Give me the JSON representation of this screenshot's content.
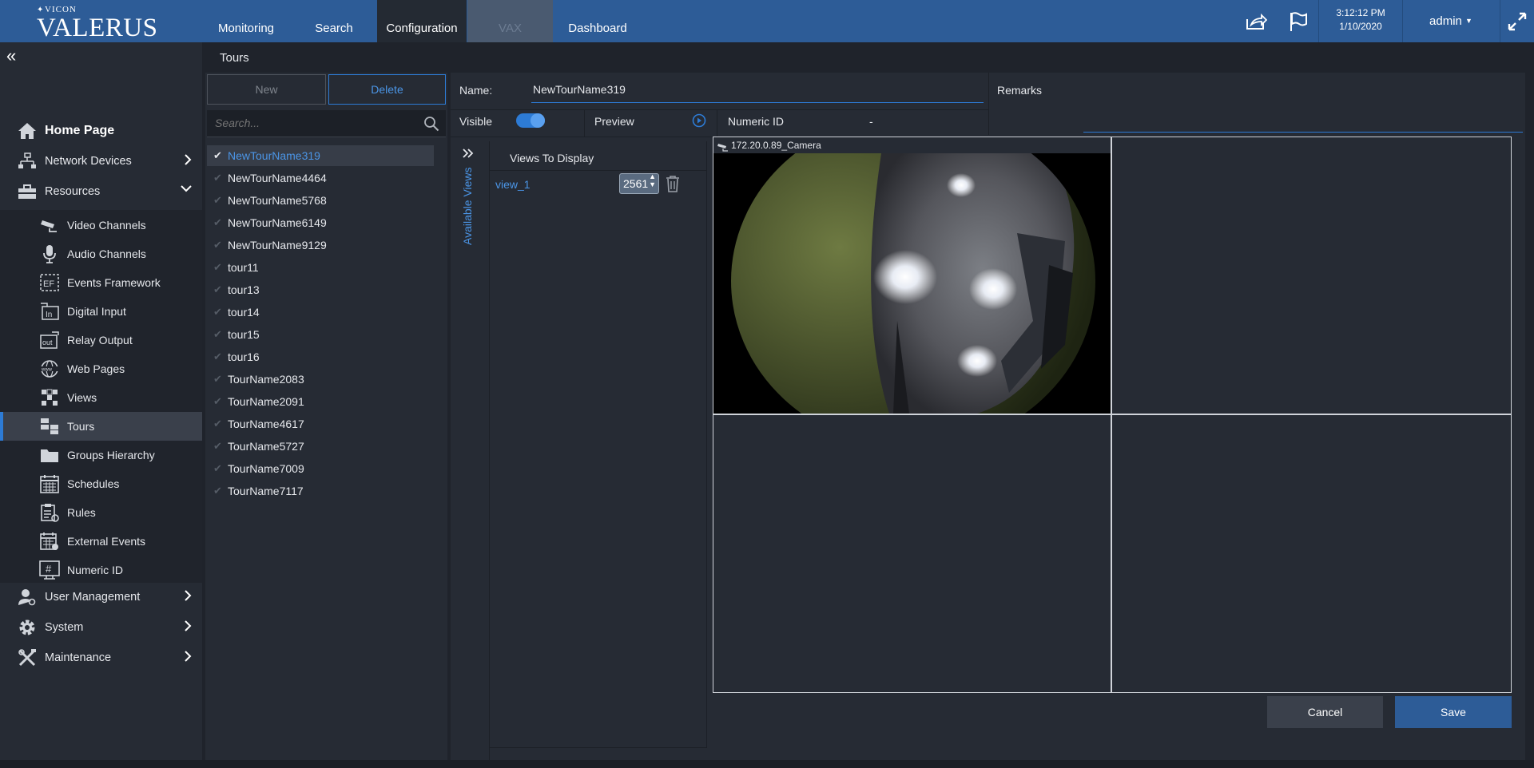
{
  "app": {
    "brand_small": "VICON",
    "brand_big": "VALERUS"
  },
  "nav": {
    "tabs": [
      {
        "label": "Monitoring"
      },
      {
        "label": "Search"
      },
      {
        "label": "Configuration"
      },
      {
        "label": "VAX"
      },
      {
        "label": "Dashboard"
      }
    ],
    "active_tab": "Configuration"
  },
  "header": {
    "time": "3:12:12 PM",
    "date": "1/10/2020",
    "user": "admin"
  },
  "sidebar": {
    "section_title": "Tours",
    "items": [
      {
        "label": "Home Page",
        "icon": "home-icon"
      },
      {
        "label": "Network Devices",
        "icon": "network-icon"
      },
      {
        "label": "Resources",
        "icon": "toolbox-icon"
      },
      {
        "label": "Video Channels",
        "icon": "camera-icon"
      },
      {
        "label": "Audio Channels",
        "icon": "microphone-icon"
      },
      {
        "label": "Events Framework",
        "icon": "events-framework-icon"
      },
      {
        "label": "Digital Input",
        "icon": "digital-input-icon"
      },
      {
        "label": "Relay Output",
        "icon": "relay-output-icon"
      },
      {
        "label": "Web Pages",
        "icon": "web-icon"
      },
      {
        "label": "Views",
        "icon": "views-icon"
      },
      {
        "label": "Tours",
        "icon": "tours-icon"
      },
      {
        "label": "Groups Hierarchy",
        "icon": "folder-icon"
      },
      {
        "label": "Schedules",
        "icon": "calendar-icon"
      },
      {
        "label": "Rules",
        "icon": "rules-icon"
      },
      {
        "label": "External Events",
        "icon": "external-events-icon"
      },
      {
        "label": "Numeric ID",
        "icon": "hash-icon"
      },
      {
        "label": "User Management",
        "icon": "user-icon"
      },
      {
        "label": "System",
        "icon": "gear-icon"
      },
      {
        "label": "Maintenance",
        "icon": "tools-icon"
      }
    ]
  },
  "tour_list": {
    "new_label": "New",
    "delete_label": "Delete",
    "search_placeholder": "Search...",
    "items": [
      "NewTourName319",
      "NewTourName4464",
      "NewTourName5768",
      "NewTourName6149",
      "NewTourName9129",
      "tour11",
      "tour13",
      "tour14",
      "tour15",
      "tour16",
      "TourName2083",
      "TourName2091",
      "TourName4617",
      "TourName5727",
      "TourName7009",
      "TourName7117"
    ],
    "selected": "NewTourName319"
  },
  "detail": {
    "name_label": "Name:",
    "name_value": "NewTourName319",
    "remarks_label": "Remarks",
    "visible_label": "Visible",
    "visible_on": true,
    "preview_label": "Preview",
    "numeric_id_label": "Numeric ID",
    "numeric_id_value": "-",
    "available_views_label": "Available Views",
    "views_to_display_label": "Views To Display",
    "views": [
      {
        "name": "view_1",
        "dwell": "2561"
      }
    ],
    "camera_title": "172.20.0.89_Camera",
    "cancel_label": "Cancel",
    "save_label": "Save"
  },
  "colors": {
    "topbar": "#2d5c97",
    "accent": "#2d7bd5",
    "panel": "#262b34",
    "background": "#1f232b"
  }
}
